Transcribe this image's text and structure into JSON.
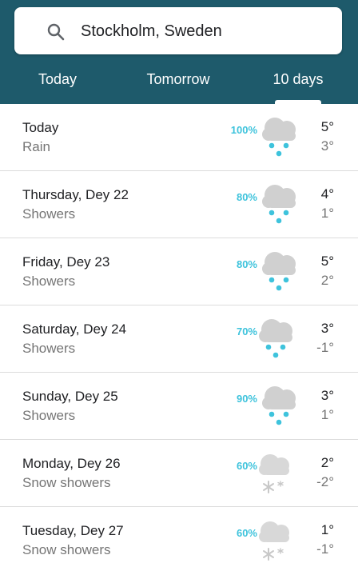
{
  "search": {
    "value": "Stockholm, Sweden",
    "icon": "search-icon"
  },
  "tabs": [
    {
      "label": "Today",
      "selected": false
    },
    {
      "label": "Tomorrow",
      "selected": false
    },
    {
      "label": "10 days",
      "selected": true
    }
  ],
  "colors": {
    "header": "#1e5a6b",
    "precip": "#3ec3dc",
    "cloud": "#d0d0d0"
  },
  "forecast": [
    {
      "day": "Today",
      "condition": "Rain",
      "precip": "100%",
      "high": "5°",
      "low": "3°",
      "icon": "rain-icon"
    },
    {
      "day": "Thursday, Dey 22",
      "condition": "Showers",
      "precip": "80%",
      "high": "4°",
      "low": "1°",
      "icon": "rain-icon"
    },
    {
      "day": "Friday, Dey 23",
      "condition": "Showers",
      "precip": "80%",
      "high": "5°",
      "low": "2°",
      "icon": "rain-icon"
    },
    {
      "day": "Saturday, Dey 24",
      "condition": "Showers",
      "precip": "70%",
      "high": "3°",
      "low": "-1°",
      "icon": "rain-icon"
    },
    {
      "day": "Sunday, Dey 25",
      "condition": "Showers",
      "precip": "90%",
      "high": "3°",
      "low": "1°",
      "icon": "rain-icon"
    },
    {
      "day": "Monday, Dey 26",
      "condition": "Snow showers",
      "precip": "60%",
      "high": "2°",
      "low": "-2°",
      "icon": "snow-icon"
    },
    {
      "day": "Tuesday, Dey 27",
      "condition": "Snow showers",
      "precip": "60%",
      "high": "1°",
      "low": "-1°",
      "icon": "snow-icon"
    }
  ]
}
